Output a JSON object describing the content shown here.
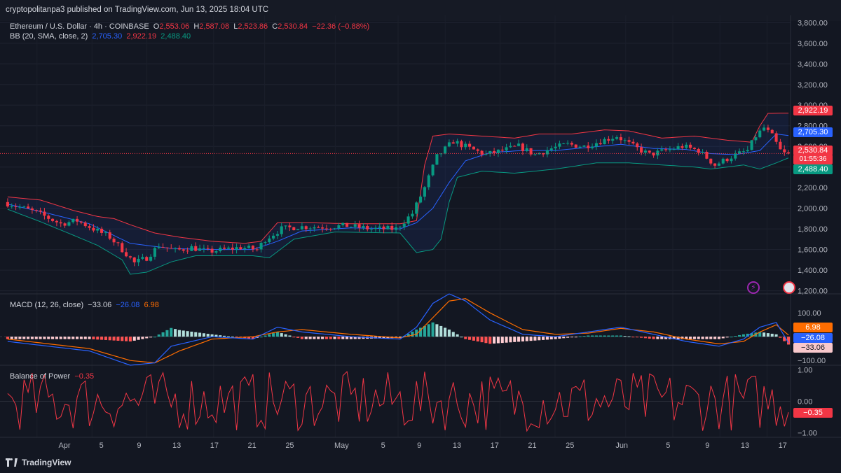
{
  "header": {
    "published_text": "cryptopolitanpa3 published on TradingView.com, Jun 13, 2025 18:04 UTC"
  },
  "legend": {
    "symbol": "Ethereum / U.S. Dollar · 4h · COINBASE",
    "o_label": "O",
    "o_value": "2,553.06",
    "h_label": "H",
    "h_value": "2,587.08",
    "l_label": "L",
    "l_value": "2,523.86",
    "c_label": "C",
    "c_value": "2,530.84",
    "change": "−22.36 (−0.88%)",
    "bb_label": "BB (20, SMA, close, 2)",
    "bb_basis": "2,705.30",
    "bb_upper": "2,922.19",
    "bb_lower": "2,488.40",
    "macd_label": "MACD (12, 26, close)",
    "macd_hist": "−33.06",
    "macd_line": "−26.08",
    "macd_signal": "6.98",
    "bop_label": "Balance of Power",
    "bop_value": "−0.35"
  },
  "price_axis": {
    "ticks": [
      "3,800.00",
      "3,600.00",
      "3,400.00",
      "3,200.00",
      "3,000.00",
      "2,800.00",
      "2,600.00",
      "2,400.00",
      "2,200.00",
      "2,000.00",
      "1,800.00",
      "1,600.00",
      "1,400.00",
      "1,200.00"
    ],
    "tick_values": [
      3800,
      3600,
      3400,
      3200,
      3000,
      2800,
      2600,
      2400,
      2200,
      2000,
      1800,
      1600,
      1400,
      1200
    ]
  },
  "macd_axis": {
    "ticks": [
      "100.00",
      "−100.00"
    ],
    "tick_values": [
      100,
      -100
    ]
  },
  "bop_axis": {
    "ticks": [
      "1.00",
      "0.00",
      "−1.00"
    ],
    "tick_values": [
      1,
      0,
      -1
    ]
  },
  "badges": {
    "upper": "2,922.19",
    "basis": "2,705.30",
    "close": "2,530.84",
    "countdown": "01:55:36",
    "lower": "2,488.40",
    "macd_signal": "6.98",
    "macd_line": "−26.08",
    "macd_hist": "−33.06",
    "bop": "−0.35"
  },
  "time_axis": {
    "labels": [
      "Apr",
      "5",
      "9",
      "13",
      "17",
      "21",
      "25",
      "May",
      "5",
      "9",
      "13",
      "17",
      "21",
      "25",
      "Jun",
      "5",
      "9",
      "13",
      "17"
    ]
  },
  "colors": {
    "background": "#131722",
    "up": "#089981",
    "down": "#f23645",
    "bb_basis": "#2962ff",
    "bb_band": "#f23645",
    "bb_lower": "#089981",
    "macd_line": "#2962ff",
    "signal_line": "#ff6d00",
    "bop": "#f23645"
  },
  "footer": {
    "brand": "TradingView"
  },
  "chart_data": {
    "type": "candlestick",
    "title": "Ethereum / U.S. Dollar · 4h · COINBASE",
    "ylim": [
      1200,
      3800
    ],
    "last_close": 2530.84,
    "price_path": [
      [
        0,
        2060
      ],
      [
        8,
        1960
      ],
      [
        14,
        1850
      ],
      [
        18,
        1880
      ],
      [
        22,
        1800
      ],
      [
        26,
        1720
      ],
      [
        30,
        1560
      ],
      [
        32,
        1470
      ],
      [
        35,
        1520
      ],
      [
        38,
        1640
      ],
      [
        42,
        1590
      ],
      [
        46,
        1620
      ],
      [
        50,
        1580
      ],
      [
        54,
        1600
      ],
      [
        58,
        1620
      ],
      [
        62,
        1600
      ],
      [
        64,
        1700
      ],
      [
        68,
        1800
      ],
      [
        72,
        1820
      ],
      [
        78,
        1820
      ],
      [
        84,
        1830
      ],
      [
        90,
        1800
      ],
      [
        96,
        1800
      ],
      [
        100,
        1950
      ],
      [
        103,
        2200
      ],
      [
        106,
        2500
      ],
      [
        110,
        2650
      ],
      [
        114,
        2580
      ],
      [
        118,
        2520
      ],
      [
        122,
        2560
      ],
      [
        126,
        2600
      ],
      [
        130,
        2520
      ],
      [
        134,
        2580
      ],
      [
        138,
        2620
      ],
      [
        142,
        2600
      ],
      [
        146,
        2650
      ],
      [
        150,
        2700
      ],
      [
        154,
        2600
      ],
      [
        158,
        2520
      ],
      [
        162,
        2560
      ],
      [
        166,
        2600
      ],
      [
        170,
        2560
      ],
      [
        174,
        2420
      ],
      [
        178,
        2500
      ],
      [
        182,
        2560
      ],
      [
        184,
        2700
      ],
      [
        186,
        2780
      ],
      [
        188,
        2700
      ],
      [
        190,
        2560
      ],
      [
        191,
        2530
      ]
    ],
    "bb_basis_path": [
      [
        0,
        2040
      ],
      [
        10,
        1950
      ],
      [
        20,
        1850
      ],
      [
        30,
        1660
      ],
      [
        40,
        1610
      ],
      [
        50,
        1600
      ],
      [
        60,
        1600
      ],
      [
        66,
        1680
      ],
      [
        72,
        1780
      ],
      [
        84,
        1810
      ],
      [
        96,
        1800
      ],
      [
        100,
        1860
      ],
      [
        104,
        2000
      ],
      [
        108,
        2250
      ],
      [
        112,
        2460
      ],
      [
        118,
        2540
      ],
      [
        126,
        2560
      ],
      [
        134,
        2560
      ],
      [
        142,
        2590
      ],
      [
        150,
        2620
      ],
      [
        158,
        2580
      ],
      [
        166,
        2570
      ],
      [
        172,
        2530
      ],
      [
        178,
        2520
      ],
      [
        184,
        2560
      ],
      [
        188,
        2720
      ],
      [
        191,
        2705.3
      ]
    ],
    "bb_upper_path": [
      [
        0,
        2110
      ],
      [
        8,
        2080
      ],
      [
        16,
        1980
      ],
      [
        22,
        1920
      ],
      [
        26,
        1900
      ],
      [
        30,
        1840
      ],
      [
        36,
        1760
      ],
      [
        42,
        1720
      ],
      [
        50,
        1680
      ],
      [
        58,
        1660
      ],
      [
        62,
        1680
      ],
      [
        66,
        1860
      ],
      [
        74,
        1860
      ],
      [
        84,
        1850
      ],
      [
        96,
        1850
      ],
      [
        100,
        1880
      ],
      [
        102,
        2420
      ],
      [
        104,
        2700
      ],
      [
        108,
        2720
      ],
      [
        116,
        2700
      ],
      [
        124,
        2680
      ],
      [
        130,
        2720
      ],
      [
        138,
        2720
      ],
      [
        146,
        2760
      ],
      [
        152,
        2750
      ],
      [
        160,
        2680
      ],
      [
        168,
        2700
      ],
      [
        176,
        2660
      ],
      [
        182,
        2640
      ],
      [
        184,
        2800
      ],
      [
        186,
        2920
      ],
      [
        191,
        2922.19
      ]
    ],
    "bb_lower_path": [
      [
        0,
        1990
      ],
      [
        8,
        1870
      ],
      [
        16,
        1740
      ],
      [
        22,
        1640
      ],
      [
        28,
        1500
      ],
      [
        30,
        1360
      ],
      [
        34,
        1380
      ],
      [
        40,
        1480
      ],
      [
        46,
        1540
      ],
      [
        54,
        1540
      ],
      [
        60,
        1540
      ],
      [
        64,
        1520
      ],
      [
        70,
        1700
      ],
      [
        80,
        1770
      ],
      [
        96,
        1760
      ],
      [
        100,
        1570
      ],
      [
        104,
        1600
      ],
      [
        106,
        1700
      ],
      [
        108,
        2060
      ],
      [
        110,
        2300
      ],
      [
        116,
        2360
      ],
      [
        124,
        2340
      ],
      [
        134,
        2380
      ],
      [
        144,
        2440
      ],
      [
        152,
        2440
      ],
      [
        160,
        2420
      ],
      [
        168,
        2400
      ],
      [
        172,
        2380
      ],
      [
        180,
        2420
      ],
      [
        184,
        2380
      ],
      [
        188,
        2440
      ],
      [
        191,
        2488.4
      ]
    ],
    "macd_range": [
      -120,
      180
    ],
    "macd_line_path": [
      [
        0,
        -20
      ],
      [
        10,
        -40
      ],
      [
        20,
        -60
      ],
      [
        30,
        -120
      ],
      [
        36,
        -110
      ],
      [
        40,
        -40
      ],
      [
        50,
        0
      ],
      [
        60,
        -10
      ],
      [
        66,
        40
      ],
      [
        72,
        20
      ],
      [
        84,
        0
      ],
      [
        96,
        -10
      ],
      [
        100,
        40
      ],
      [
        104,
        140
      ],
      [
        108,
        180
      ],
      [
        112,
        150
      ],
      [
        118,
        70
      ],
      [
        126,
        10
      ],
      [
        134,
        0
      ],
      [
        142,
        20
      ],
      [
        150,
        40
      ],
      [
        158,
        10
      ],
      [
        166,
        -20
      ],
      [
        174,
        -40
      ],
      [
        180,
        -10
      ],
      [
        184,
        40
      ],
      [
        188,
        60
      ],
      [
        191,
        -26.08
      ]
    ],
    "signal_line_path": [
      [
        0,
        -10
      ],
      [
        10,
        -30
      ],
      [
        20,
        -50
      ],
      [
        30,
        -100
      ],
      [
        36,
        -110
      ],
      [
        42,
        -60
      ],
      [
        50,
        -10
      ],
      [
        60,
        0
      ],
      [
        66,
        20
      ],
      [
        72,
        30
      ],
      [
        84,
        10
      ],
      [
        96,
        -5
      ],
      [
        100,
        10
      ],
      [
        104,
        80
      ],
      [
        108,
        150
      ],
      [
        112,
        160
      ],
      [
        118,
        100
      ],
      [
        126,
        30
      ],
      [
        134,
        10
      ],
      [
        142,
        15
      ],
      [
        150,
        35
      ],
      [
        158,
        20
      ],
      [
        166,
        -10
      ],
      [
        174,
        -30
      ],
      [
        180,
        -20
      ],
      [
        184,
        20
      ],
      [
        188,
        50
      ],
      [
        191,
        6.98
      ]
    ],
    "bop_range": [
      -1.15,
      1.15
    ],
    "last_bop": -0.35,
    "bars": 192
  }
}
